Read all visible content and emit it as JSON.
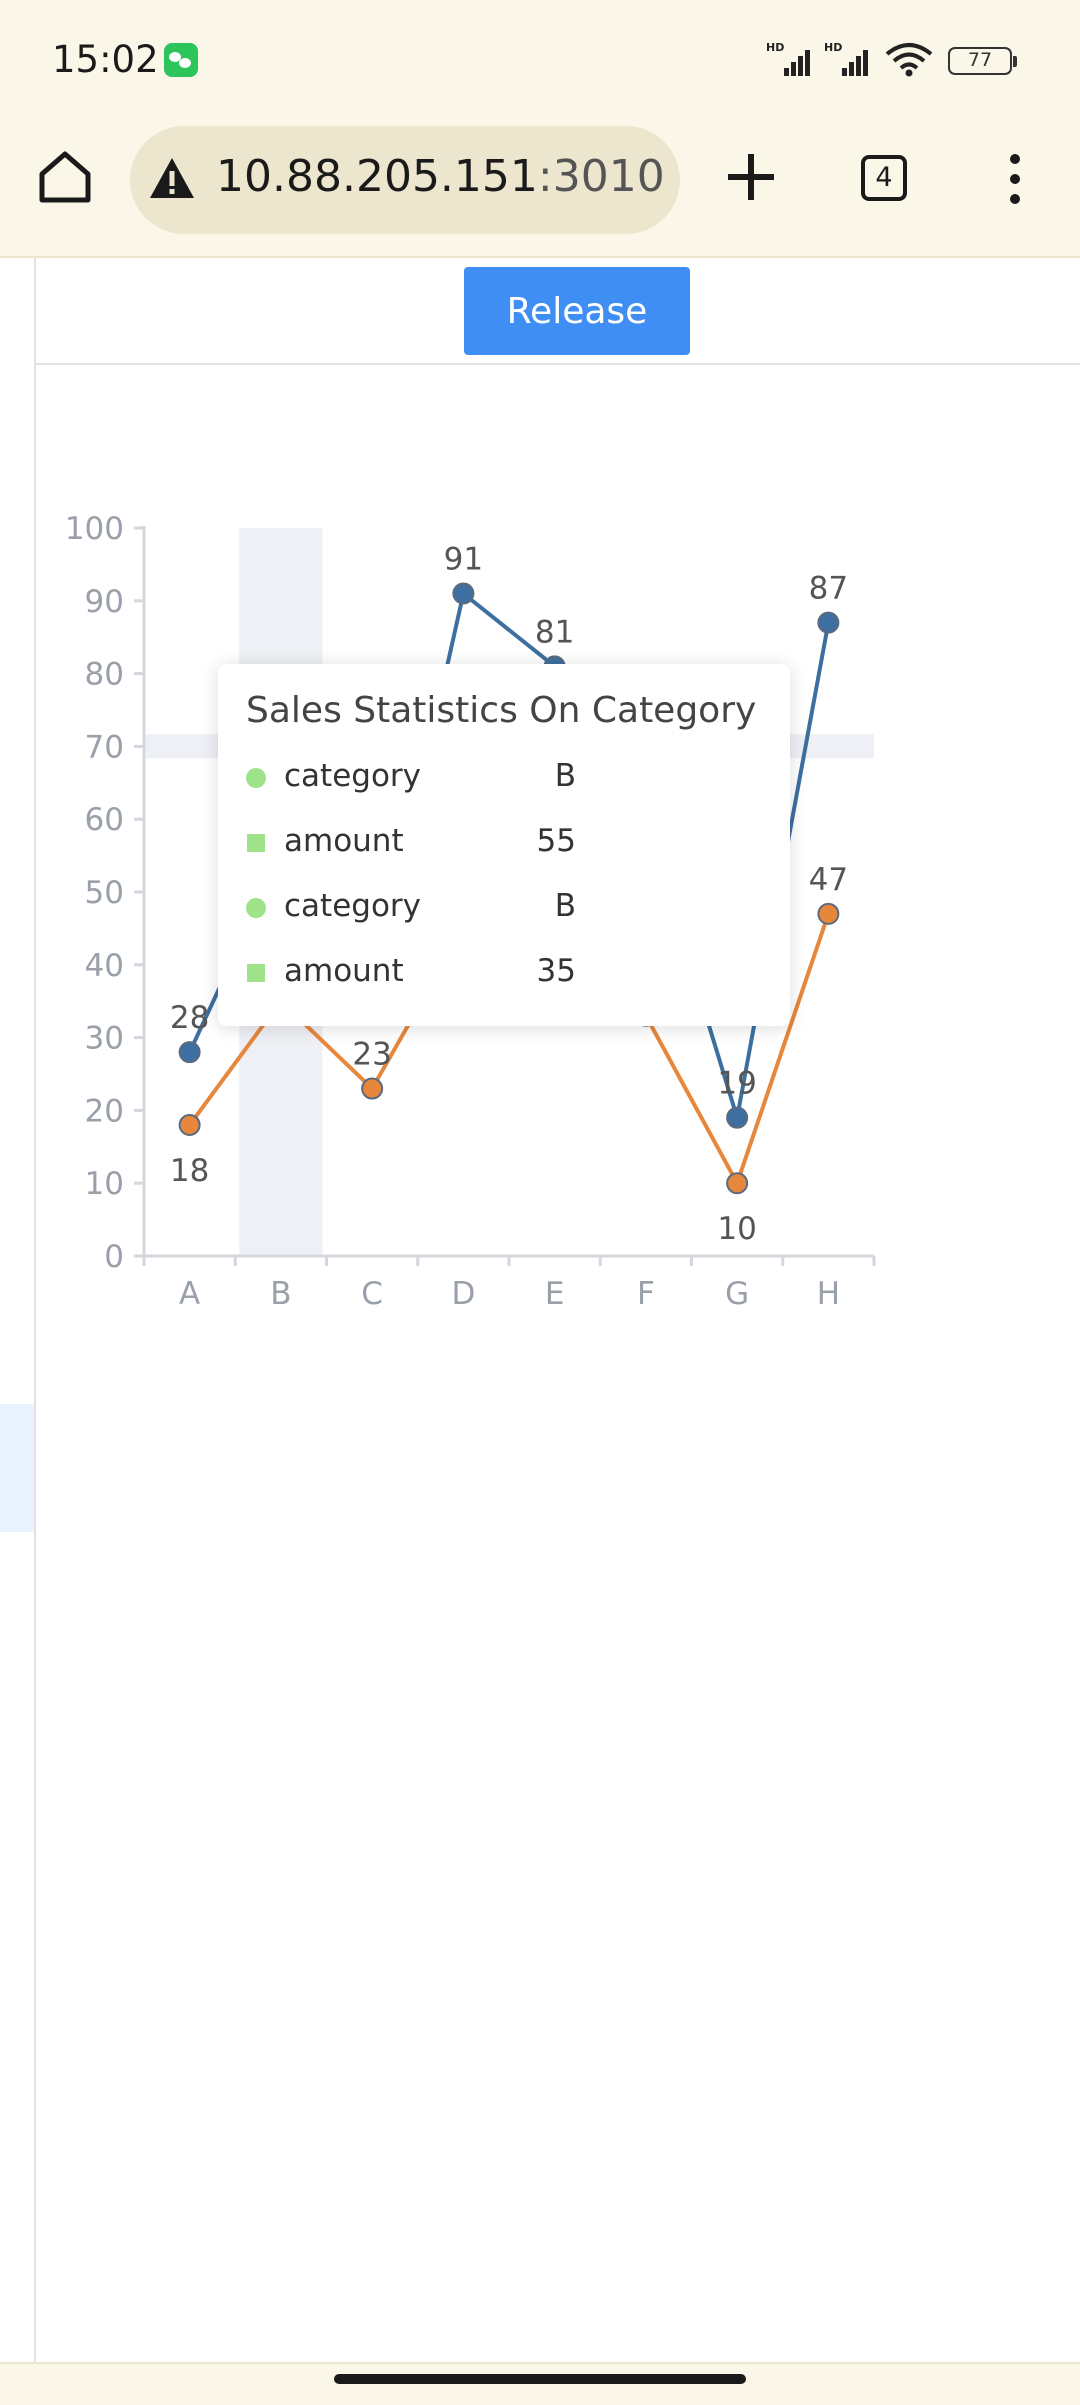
{
  "status_bar": {
    "time": "15:02",
    "battery": "77"
  },
  "browser": {
    "url_host": "10.88.205.151",
    "url_port": ":3010",
    "tab_count": "4"
  },
  "toolbar": {
    "release_label": "Release"
  },
  "chart_data": {
    "type": "line",
    "categories": [
      "A",
      "B",
      "C",
      "D",
      "E",
      "F",
      "G",
      "H"
    ],
    "ylim": [
      0,
      100
    ],
    "yticks": [
      0,
      10,
      20,
      30,
      40,
      50,
      60,
      70,
      80,
      90,
      100
    ],
    "series": [
      {
        "color": "#3d6fa0",
        "values": [
          28,
          55,
          35,
          91,
          81,
          60,
          19,
          87
        ]
      },
      {
        "color": "#e6873c",
        "values": [
          18,
          35,
          23,
          45,
          50,
          33,
          10,
          47
        ]
      }
    ],
    "shown_labels": [
      {
        "series": 0,
        "index": 0,
        "text": "28"
      },
      {
        "series": 0,
        "index": 3,
        "text": "91"
      },
      {
        "series": 0,
        "index": 4,
        "text": "81"
      },
      {
        "series": 0,
        "index": 6,
        "text": "19"
      },
      {
        "series": 0,
        "index": 7,
        "text": "87"
      },
      {
        "series": 1,
        "index": 0,
        "text": "18"
      },
      {
        "series": 1,
        "index": 2,
        "text": "23"
      },
      {
        "series": 1,
        "index": 6,
        "text": "10"
      },
      {
        "series": 1,
        "index": 7,
        "text": "47"
      }
    ],
    "highlight_category": "B",
    "crosshair_value": 70,
    "grid": false
  },
  "tooltip": {
    "title": "Sales Statistics On Category",
    "rows": [
      {
        "label": "category",
        "value": "B"
      },
      {
        "label": "amount",
        "value": "55"
      },
      {
        "label": "category",
        "value": "B"
      },
      {
        "label": "amount",
        "value": "35"
      }
    ],
    "marker_color": "#9ee28a"
  }
}
